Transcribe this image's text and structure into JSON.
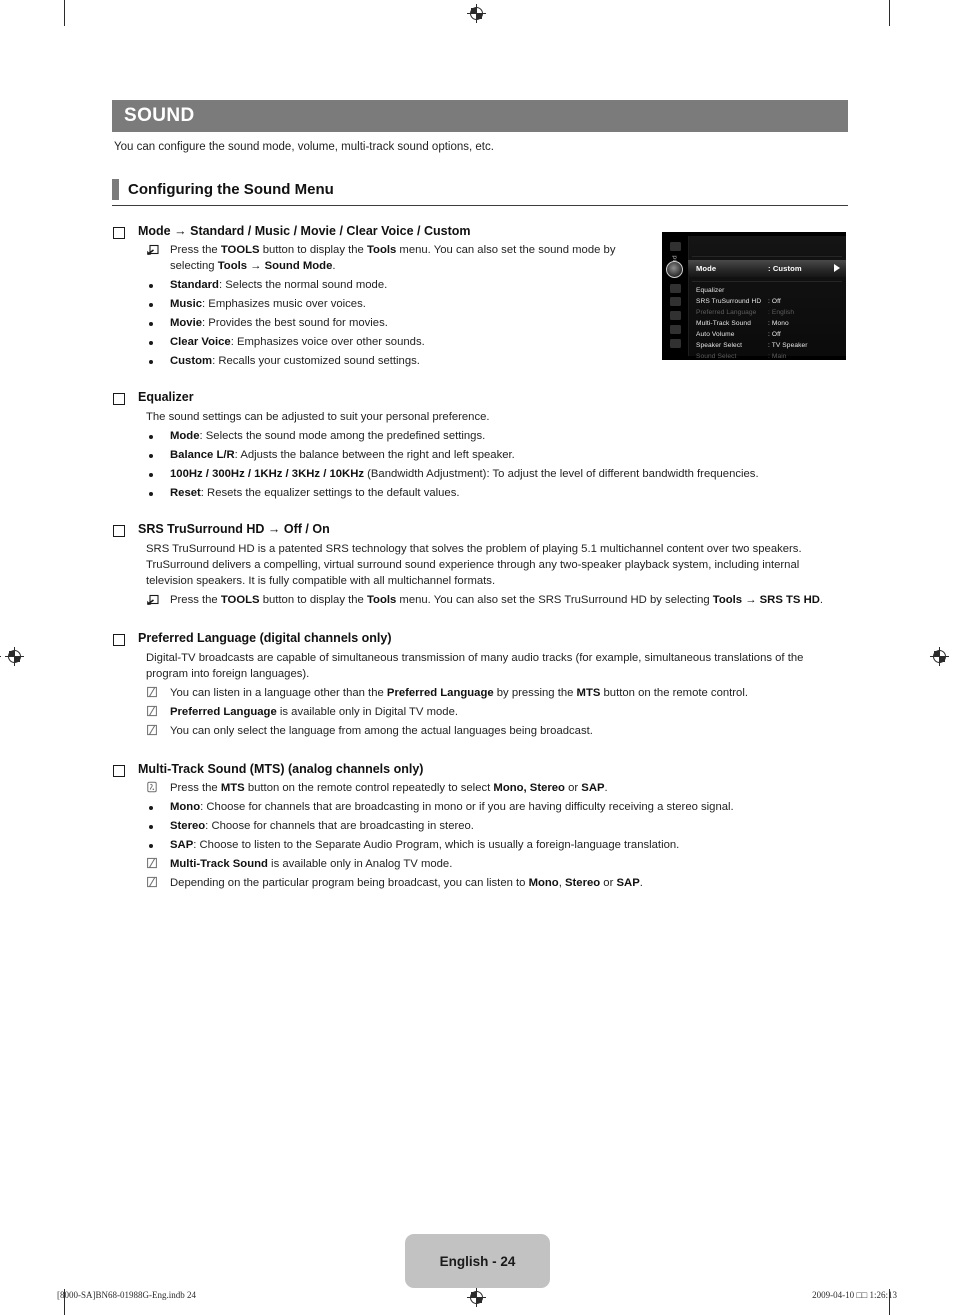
{
  "chapter": {
    "title": "SOUND",
    "description": "You can configure the sound mode, volume, multi-track sound options, etc."
  },
  "section": {
    "title": "Configuring the Sound Menu"
  },
  "blocks": {
    "mode": {
      "heading": "Mode → Standard / Music / Movie / Clear Voice / Custom",
      "tools_note": "Press the TOOLS button to display the Tools menu. You can also set the sound mode by selecting Tools → Sound Mode.",
      "items": [
        "Standard: Selects the normal sound mode.",
        "Music: Emphasizes music over voices.",
        "Movie: Provides the best sound for movies.",
        "Clear Voice: Emphasizes voice over other sounds.",
        "Custom: Recalls your customized sound settings."
      ]
    },
    "equalizer": {
      "heading": "Equalizer",
      "intro": "The sound settings can be adjusted to suit your personal preference.",
      "items": [
        "Mode: Selects the sound mode among the predefined settings.",
        "Balance L/R: Adjusts the balance between the right and left speaker.",
        "100Hz / 300Hz / 1KHz / 3KHz / 10KHz (Bandwidth Adjustment): To adjust the level of different bandwidth frequencies.",
        "Reset: Resets the equalizer settings to the default values."
      ]
    },
    "srs": {
      "heading": "SRS TruSurround HD → Off / On",
      "intro": "SRS TruSurround HD is a patented SRS technology that solves the problem of playing 5.1 multichannel content over two speakers. TruSurround delivers a compelling, virtual surround sound experience through any two-speaker playback system, including internal television speakers. It is fully compatible with all multichannel formats.",
      "tools_note": "Press the TOOLS button to display the Tools menu. You can also set the SRS TruSurround HD by selecting Tools → SRS TS HD."
    },
    "preferred_language": {
      "heading": "Preferred Language (digital channels only)",
      "intro": "Digital-TV broadcasts are capable of simultaneous transmission of many audio tracks (for example, simultaneous translations of the program into foreign languages).",
      "notes": [
        "You can listen in a language other than the Preferred Language by pressing the MTS button on the remote control.",
        "Preferred Language is available only in Digital TV mode.",
        "You can only select the language from among the actual languages being broadcast."
      ]
    },
    "mts": {
      "heading": "Multi-Track Sound (MTS) (analog channels only)",
      "remote_note": "Press the MTS button on the remote control repeatedly to select Mono, Stereo or SAP.",
      "items": [
        "Mono: Choose for channels that are broadcasting in mono or if you are having difficulty receiving a stereo signal.",
        "Stereo: Choose for channels that are broadcasting in stereo.",
        "SAP: Choose to listen to the Separate Audio Program, which is usually a foreign-language translation."
      ],
      "notes": [
        "Multi-Track Sound is available only in Analog TV mode.",
        "Depending on the particular program being broadcast, you can listen to Mono, Stereo or SAP."
      ]
    }
  },
  "osd": {
    "rail_label": "Sound",
    "rows": [
      {
        "key": "Mode",
        "value": ": Custom",
        "state": "active"
      },
      {
        "key": "Equalizer",
        "value": "",
        "state": "on"
      },
      {
        "key": "SRS TruSurround HD",
        "value": ": Off",
        "state": "on"
      },
      {
        "key": "Preferred Language",
        "value": ": English",
        "state": "dim"
      },
      {
        "key": "Multi-Track Sound",
        "value": ": Mono",
        "state": "on"
      },
      {
        "key": "Auto Volume",
        "value": ": Off",
        "state": "on"
      },
      {
        "key": "Speaker Select",
        "value": ": TV Speaker",
        "state": "on"
      },
      {
        "key": "Sound Select",
        "value": ": Main",
        "state": "dim"
      }
    ]
  },
  "footer": {
    "page_label": "English - 24",
    "file_ref": "[8000-SA]BN68-01988G-Eng.indb   24",
    "timestamp": "2009-04-10   □□ 1:26:13"
  },
  "colors": {
    "chapter_bar": "#7b7b7b",
    "accent_bar": "#7b7b7b",
    "badge": "#c2c2c2",
    "osd_background": "#000000"
  },
  "icons": {
    "section_bullet": "open-square",
    "tools": "tools-jump-icon",
    "note": "note-pencil-icon",
    "remote": "remote-button-icon",
    "list_bullet": "filled-dot"
  }
}
